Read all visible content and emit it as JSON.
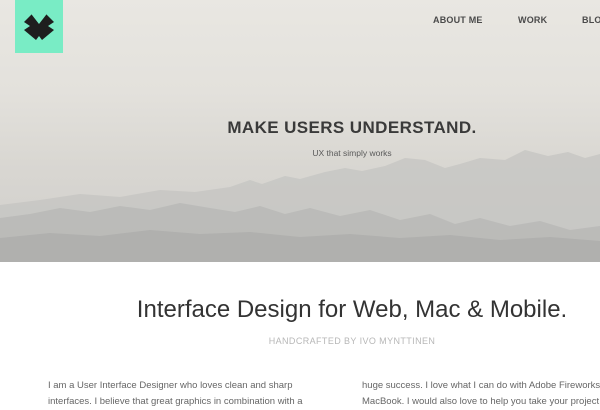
{
  "logo": {
    "icon": "m-logo-icon",
    "color": "#79ecc5"
  },
  "nav": {
    "items": [
      {
        "label": "ABOUT ME"
      },
      {
        "label": "WORK"
      },
      {
        "label": "BLOG"
      }
    ]
  },
  "hero": {
    "title": "MAKE USERS UNDERSTAND.",
    "subtitle": "UX that simply works"
  },
  "section": {
    "title": "Interface Design for Web, Mac & Mobile.",
    "subtitle": "HANDCRAFTED BY IVO MYNTTINEN"
  },
  "intro": {
    "left_line1": "I am a User Interface Designer who loves clean and sharp",
    "left_line2": "interfaces. I believe that great graphics in combination with a",
    "right_line1": "huge success. I love what I can do with Adobe Fireworks",
    "right_line2": "MacBook. I would also love to help you take your project"
  }
}
